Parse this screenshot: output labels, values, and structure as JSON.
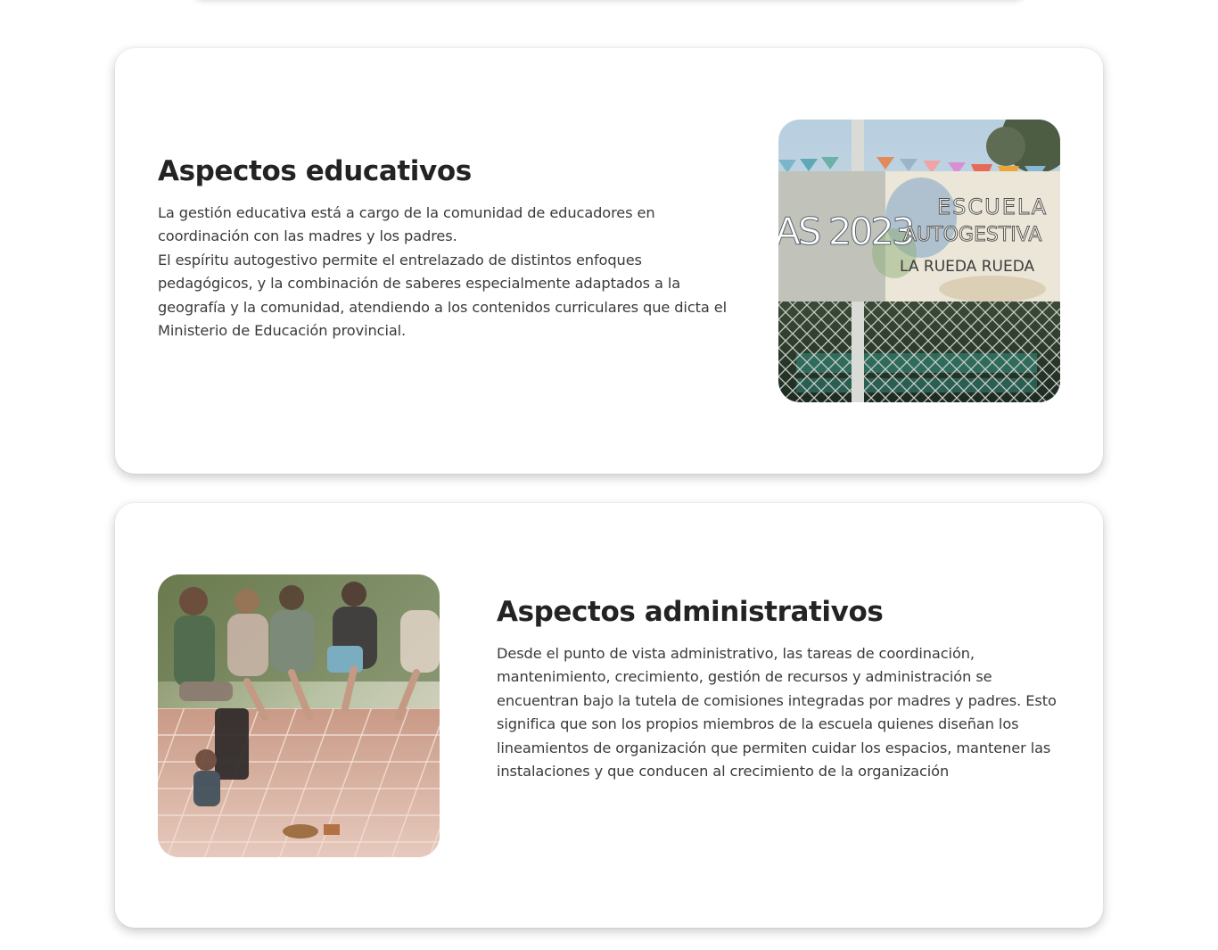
{
  "sections": [
    {
      "title": "Aspectos educativos",
      "paragraphs": [
        "La gestión educativa está a cargo de la comunidad de educadores en coordinación con las madres y los padres.",
        "El espíritu autogestivo permite el entrelazado de distintos enfoques pedagógicos, y la combinación de saberes especialmente adaptados a la geografía y la comunidad, atendiendo a los contenidos curriculares que dicta el Ministerio de Educación provincial."
      ],
      "photo": {
        "banner_left_text": "AS 2023",
        "banner_line1": "ESCUELA",
        "banner_line2": "AUTOGESTIVA",
        "banner_line3": "LA RUEDA RUEDA"
      }
    },
    {
      "title": "Aspectos administrativos",
      "paragraphs": [
        "Desde el punto de vista administrativo, las tareas de coordinación, mantenimiento, crecimiento, gestión de recursos y administración se encuentran bajo la tutela de comisiones integradas por madres y padres. Esto significa que son los propios miembros de la escuela quienes diseñan los lineamientos de organización que permiten cuidar los espacios, mantener las instalaciones y que conducen al crecimiento de la organización"
      ]
    }
  ]
}
